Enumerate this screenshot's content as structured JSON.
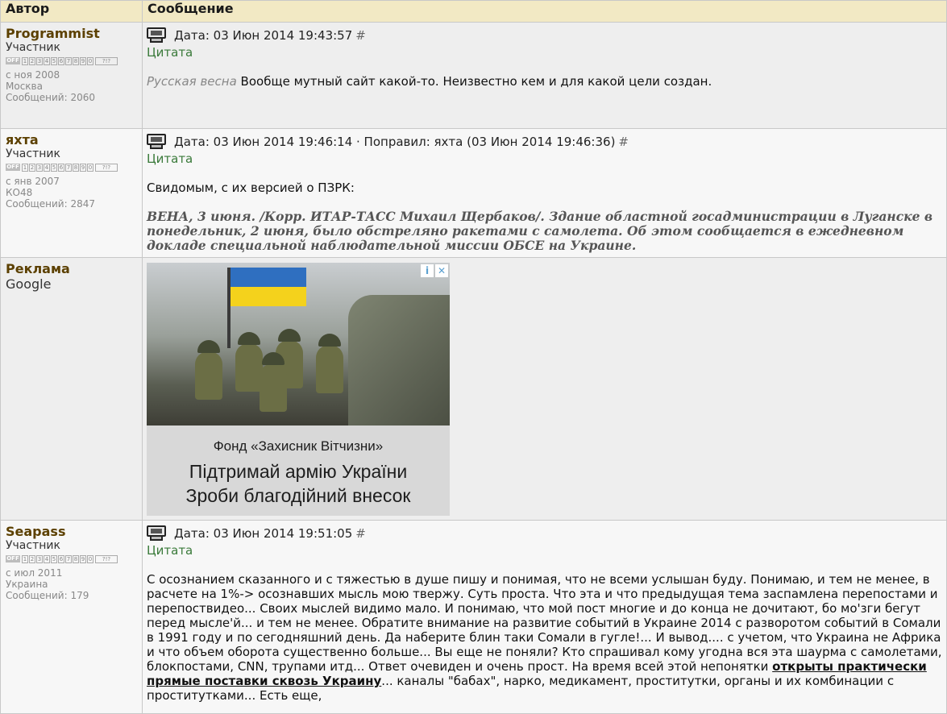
{
  "header": {
    "author_col": "Автор",
    "message_col": "Сообщение"
  },
  "posts": [
    {
      "username": "Programmist",
      "role": "Участник",
      "since": "с ноя 2008",
      "city": "Москва",
      "posts_count": "Сообщений: 2060",
      "date_line": "Дата: 03 Июн 2014 19:43:57",
      "hash": "#",
      "quote": "Цитата",
      "italic_prefix": "Русская весна",
      "text": " Вообще мутный сайт какой-то. Неизвестно кем и для какой цели создан."
    },
    {
      "username": "яхта",
      "role": "Участник",
      "since": "с янв 2007",
      "city": "КО48",
      "posts_count": "Сообщений: 2847",
      "date_line": "Дата: 03 Июн 2014 19:46:14 · Поправил: яхта (03 Июн 2014 19:46:36)",
      "hash": "#",
      "quote": "Цитата",
      "text": "Свидомым, с их версией о ПЗРК:",
      "quote_text": "ВЕНА, 3 июня. /Корр. ИТАР-ТАСС Михаил Щербаков/. Здание областной госадминистрации в Луганске в понедельник, 2 июня, было обстреляно ракетами с самолета. Об этом сообщается в ежедневном докладе специальной наблюдательной миссии ОБСЕ на Украине."
    },
    {
      "username": "Seapass",
      "role": "Участник",
      "since": "с июл 2011",
      "city": "Украина",
      "posts_count": "Сообщений: 179",
      "date_line": "Дата: 03 Июн 2014 19:51:05",
      "hash": "#",
      "quote": "Цитата",
      "text_a": "С осознанием сказанного и с тяжестью в душе пишу и понимая, что не всеми услышан буду. Понимаю, и тем не менее, в расчете на 1%-> осознавших мысль мою твержу. Суть проста. Что эта и что предыдущая тема заспамлена перепостами и перепоствидео... Своих мыслей видимо мало. И понимаю, что мой пост многие и до конца не дочитают, бо мо'зги бегут перед мысле'й... и тем не менее. Обратите внимание на развитие событий в Украине 2014 с разворотом событий в Сомали в 1991 году и по сегодняшний день. Да наберите блин таки Сомали в гугле!... И вывод.... с учетом, что Украина не Африка и что объем оборота существенно больше... Вы еще не поняли? Кто спрашивал кому угодна вся эта шаурма с самолетами, блокпостами, CNN, трупами итд... Ответ очевиден и очень прост. На время всей этой непонятки ",
      "text_link": "открыты практически прямые поставки сквозь Украину",
      "text_b": "... каналы \"бабах\", нарко, медикамент, проститутки, органы и их комбинации с проститутками... Есть еще,"
    }
  ],
  "ad": {
    "label": "Реклама",
    "sub": "Google",
    "line1": "Фонд «Захисник Вітчизни»",
    "line2": "Підтримай армію України",
    "line3": "Зроби благодійний внесок",
    "info_icon": "i",
    "close_icon": "✕"
  },
  "rating_widget": {
    "off_label": "OFF",
    "digits": [
      "1",
      "2",
      "3",
      "4",
      "5",
      "6",
      "7",
      "8",
      "9",
      "0"
    ],
    "q_label": "?!?"
  }
}
